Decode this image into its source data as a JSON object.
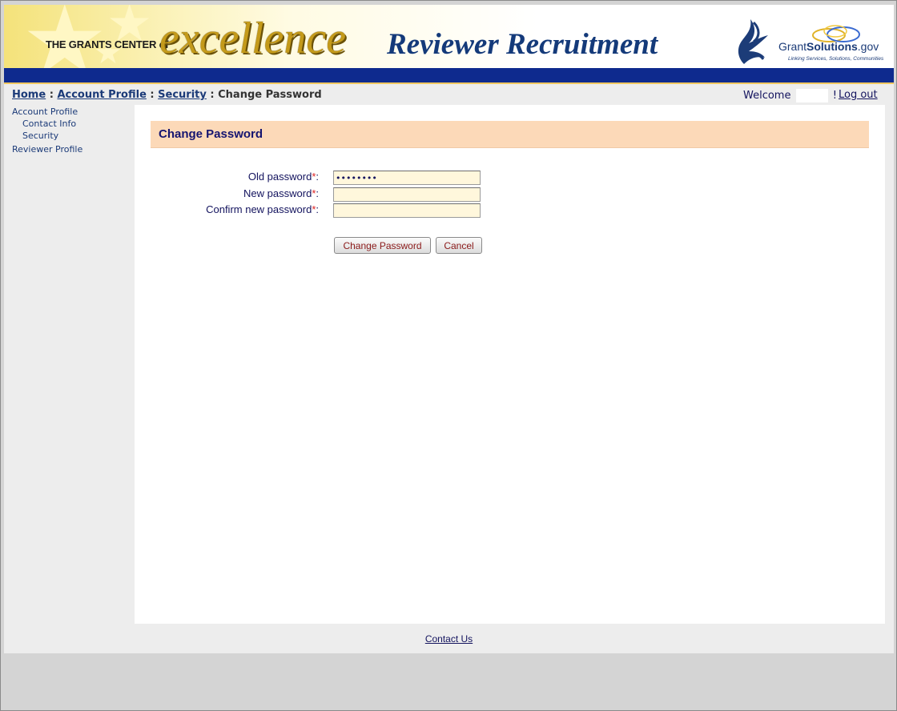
{
  "banner": {
    "grants_center": "THE GRANTS CENTER of",
    "excellence": "excellence",
    "title": "Reviewer Recruitment",
    "logo_brand_prefix": "Grant",
    "logo_brand_bold": "Solutions",
    "logo_brand_suffix": ".gov",
    "logo_tagline": "Linking Services, Solutions, Communities"
  },
  "breadcrumb": {
    "home": "Home",
    "account_profile": "Account Profile",
    "security": "Security",
    "current": "Change Password",
    "separator": " : "
  },
  "header": {
    "welcome_label": "Welcome",
    "welcome_suffix": "!",
    "logout": "Log out"
  },
  "sidebar": {
    "items": [
      {
        "label": "Account Profile",
        "level": 0
      },
      {
        "label": "Contact Info",
        "level": 1
      },
      {
        "label": "Security",
        "level": 1
      },
      {
        "label": "Reviewer Profile",
        "level": 0
      }
    ]
  },
  "form": {
    "section_title": "Change Password",
    "old_password_label": "Old password",
    "new_password_label": "New password",
    "confirm_password_label": "Confirm new password",
    "required_marker": "*",
    "label_suffix": ":",
    "old_password_value": "12345678",
    "new_password_value": "",
    "confirm_password_value": "",
    "submit_label": "Change Password",
    "cancel_label": "Cancel"
  },
  "footer": {
    "contact_us": "Contact Us"
  },
  "colors": {
    "nav_blue": "#0e2a8e",
    "section_header_bg": "#fcd9b8",
    "input_bg": "#fff7dc",
    "title_navy": "#141470"
  }
}
